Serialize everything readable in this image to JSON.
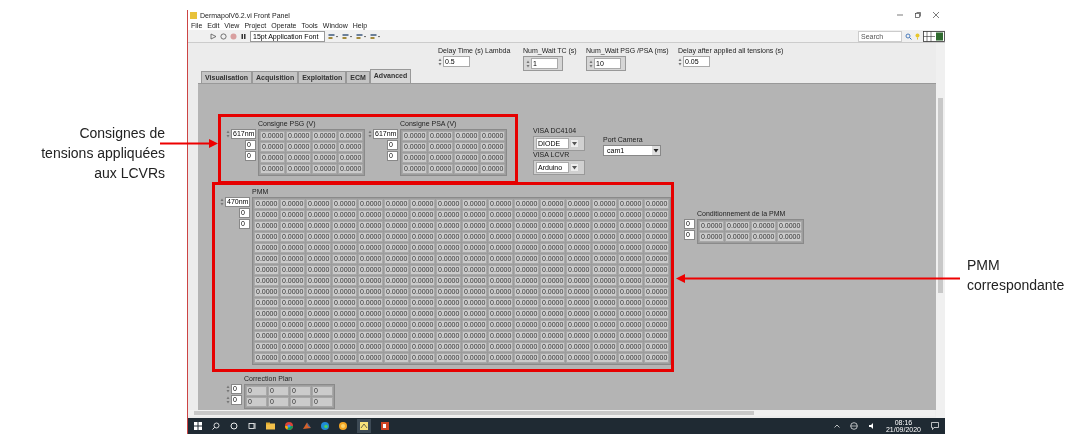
{
  "annotations": [
    {
      "text": "Consignes de tensions appliquées aux LCVRs"
    },
    {
      "text": "PMM correspondante"
    }
  ],
  "window": {
    "title": "DermapolV6.2.vi Front Panel"
  },
  "menu": [
    "File",
    "Edit",
    "View",
    "Project",
    "Operate",
    "Tools",
    "Window",
    "Help"
  ],
  "toolbar": {
    "font": "15pt Application Font",
    "search": {
      "placeholder": "Search"
    }
  },
  "top_controls": [
    {
      "label": "Delay Time (s) Lambda",
      "value": "0.5",
      "kind": "numeric"
    },
    {
      "label": "Num_Wait TC (s)",
      "value": "1",
      "kind": "framed"
    },
    {
      "label": "Num_Wait PSG /PSA (ms)",
      "value": "10",
      "kind": "framed"
    },
    {
      "label": "Delay after applied all tensions (s)",
      "value": "0.05",
      "kind": "numeric"
    }
  ],
  "tabs": [
    {
      "label": "Visualisation",
      "selected": false
    },
    {
      "label": "Acquisition",
      "selected": false
    },
    {
      "label": "Exploitation",
      "selected": false
    },
    {
      "label": "ECM",
      "selected": false
    },
    {
      "label": "Advanced",
      "selected": true
    }
  ],
  "consignes": [
    {
      "label": "Consigne PSG (V)",
      "index": [
        "617nm",
        "0",
        "0"
      ],
      "rows": [
        [
          "0.0000",
          "0.0000",
          "0.0000",
          "0.0000"
        ],
        [
          "0.0000",
          "0.0000",
          "0.0000",
          "0.0000"
        ],
        [
          "0.0000",
          "0.0000",
          "0.0000",
          "0.0000"
        ],
        [
          "0.0000",
          "0.0000",
          "0.0000",
          "0.0000"
        ]
      ]
    },
    {
      "label": "Consigne PSA (V)",
      "index": [
        "617nm",
        "0",
        "0"
      ],
      "rows": [
        [
          "0.0000",
          "0.0000",
          "0.0000",
          "0.0000"
        ],
        [
          "0.0000",
          "0.0000",
          "0.0000",
          "0.0000"
        ],
        [
          "0.0000",
          "0.0000",
          "0.0000",
          "0.0000"
        ],
        [
          "0.0000",
          "0.0000",
          "0.0000",
          "0.0000"
        ]
      ]
    }
  ],
  "visa": [
    {
      "label": "VISA DC4104",
      "value": "DIODE"
    },
    {
      "label": "VISA  LCVR",
      "value": "Arduino"
    }
  ],
  "port_camera": {
    "label": "Port Camera",
    "value": "cam1"
  },
  "pmm": {
    "label": "PMM",
    "index": [
      "470nm",
      "0",
      "0"
    ],
    "rows": [
      [
        "0.0000",
        "0.0000",
        "0.0000",
        "0.0000",
        "0.0000",
        "0.0000",
        "0.0000",
        "0.0000",
        "0.0000",
        "0.0000",
        "0.0000",
        "0.0000",
        "0.0000",
        "0.0000",
        "0.0000",
        "0.0000"
      ],
      [
        "0.0000",
        "0.0000",
        "0.0000",
        "0.0000",
        "0.0000",
        "0.0000",
        "0.0000",
        "0.0000",
        "0.0000",
        "0.0000",
        "0.0000",
        "0.0000",
        "0.0000",
        "0.0000",
        "0.0000",
        "0.0000"
      ],
      [
        "0.0000",
        "0.0000",
        "0.0000",
        "0.0000",
        "0.0000",
        "0.0000",
        "0.0000",
        "0.0000",
        "0.0000",
        "0.0000",
        "0.0000",
        "0.0000",
        "0.0000",
        "0.0000",
        "0.0000",
        "0.0000"
      ],
      [
        "0.0000",
        "0.0000",
        "0.0000",
        "0.0000",
        "0.0000",
        "0.0000",
        "0.0000",
        "0.0000",
        "0.0000",
        "0.0000",
        "0.0000",
        "0.0000",
        "0.0000",
        "0.0000",
        "0.0000",
        "0.0000"
      ],
      [
        "0.0000",
        "0.0000",
        "0.0000",
        "0.0000",
        "0.0000",
        "0.0000",
        "0.0000",
        "0.0000",
        "0.0000",
        "0.0000",
        "0.0000",
        "0.0000",
        "0.0000",
        "0.0000",
        "0.0000",
        "0.0000"
      ],
      [
        "0.0000",
        "0.0000",
        "0.0000",
        "0.0000",
        "0.0000",
        "0.0000",
        "0.0000",
        "0.0000",
        "0.0000",
        "0.0000",
        "0.0000",
        "0.0000",
        "0.0000",
        "0.0000",
        "0.0000",
        "0.0000"
      ],
      [
        "0.0000",
        "0.0000",
        "0.0000",
        "0.0000",
        "0.0000",
        "0.0000",
        "0.0000",
        "0.0000",
        "0.0000",
        "0.0000",
        "0.0000",
        "0.0000",
        "0.0000",
        "0.0000",
        "0.0000",
        "0.0000"
      ],
      [
        "0.0000",
        "0.0000",
        "0.0000",
        "0.0000",
        "0.0000",
        "0.0000",
        "0.0000",
        "0.0000",
        "0.0000",
        "0.0000",
        "0.0000",
        "0.0000",
        "0.0000",
        "0.0000",
        "0.0000",
        "0.0000"
      ],
      [
        "0.0000",
        "0.0000",
        "0.0000",
        "0.0000",
        "0.0000",
        "0.0000",
        "0.0000",
        "0.0000",
        "0.0000",
        "0.0000",
        "0.0000",
        "0.0000",
        "0.0000",
        "0.0000",
        "0.0000",
        "0.0000"
      ],
      [
        "0.0000",
        "0.0000",
        "0.0000",
        "0.0000",
        "0.0000",
        "0.0000",
        "0.0000",
        "0.0000",
        "0.0000",
        "0.0000",
        "0.0000",
        "0.0000",
        "0.0000",
        "0.0000",
        "0.0000",
        "0.0000"
      ],
      [
        "0.0000",
        "0.0000",
        "0.0000",
        "0.0000",
        "0.0000",
        "0.0000",
        "0.0000",
        "0.0000",
        "0.0000",
        "0.0000",
        "0.0000",
        "0.0000",
        "0.0000",
        "0.0000",
        "0.0000",
        "0.0000"
      ],
      [
        "0.0000",
        "0.0000",
        "0.0000",
        "0.0000",
        "0.0000",
        "0.0000",
        "0.0000",
        "0.0000",
        "0.0000",
        "0.0000",
        "0.0000",
        "0.0000",
        "0.0000",
        "0.0000",
        "0.0000",
        "0.0000"
      ],
      [
        "0.0000",
        "0.0000",
        "0.0000",
        "0.0000",
        "0.0000",
        "0.0000",
        "0.0000",
        "0.0000",
        "0.0000",
        "0.0000",
        "0.0000",
        "0.0000",
        "0.0000",
        "0.0000",
        "0.0000",
        "0.0000"
      ],
      [
        "0.0000",
        "0.0000",
        "0.0000",
        "0.0000",
        "0.0000",
        "0.0000",
        "0.0000",
        "0.0000",
        "0.0000",
        "0.0000",
        "0.0000",
        "0.0000",
        "0.0000",
        "0.0000",
        "0.0000",
        "0.0000"
      ],
      [
        "0.0000",
        "0.0000",
        "0.0000",
        "0.0000",
        "0.0000",
        "0.0000",
        "0.0000",
        "0.0000",
        "0.0000",
        "0.0000",
        "0.0000",
        "0.0000",
        "0.0000",
        "0.0000",
        "0.0000",
        "0.0000"
      ]
    ]
  },
  "conditionnement": {
    "label": "Conditionnement de la  PMM",
    "index": [
      "0",
      "0"
    ],
    "rows": [
      [
        "0.0000",
        "0.0000",
        "0.0000",
        "0.0000"
      ],
      [
        "0.0000",
        "0.0000",
        "0.0000",
        "0.0000"
      ]
    ]
  },
  "correction": {
    "label": "Correction Plan",
    "index": [
      "0",
      "0"
    ],
    "rows": [
      [
        "0",
        "0",
        "0",
        "0"
      ],
      [
        "0",
        "0",
        "0",
        "0"
      ]
    ]
  },
  "taskbar": {
    "time": "08:16",
    "date": "21/09/2020"
  }
}
